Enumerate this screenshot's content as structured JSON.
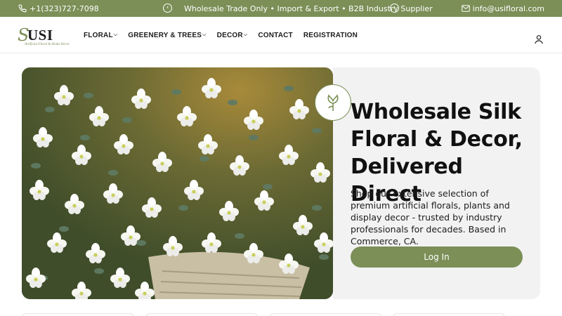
{
  "topbar": {
    "phone": "+1(323)727-7098",
    "message": "Wholesale Trade Only  •  Import & Export  •  B2B Industry Supplier",
    "email": "info@usifloral.com",
    "prev_icon": "chevron-left-circle-icon",
    "next_icon": "chevron-right-circle-icon"
  },
  "header": {
    "logo_text": "USI",
    "logo_tagline": "Artificial Floral & Home Décor",
    "nav": [
      {
        "label": "FLORAL",
        "has_dropdown": true
      },
      {
        "label": "GREENERY & TREES",
        "has_dropdown": true
      },
      {
        "label": "DECOR",
        "has_dropdown": true
      },
      {
        "label": "CONTACT",
        "has_dropdown": false
      },
      {
        "label": "REGISTRATION",
        "has_dropdown": false
      }
    ],
    "user_icon": "user-icon"
  },
  "hero": {
    "title": "Wholesale Silk Floral & Decor, Delivered Direct",
    "description": "Shop our extensive selection of premium artificial florals, plants and display decor - trusted by industry professionals for decades. Based in Commerce, CA.",
    "cta_label": "Log In",
    "image_alt": "white orchids and eucalyptus arrangement in wicker basket"
  },
  "colors": {
    "brand_green": "#7b8f57",
    "card_bg": "#f2f2f2",
    "text": "#111111"
  }
}
